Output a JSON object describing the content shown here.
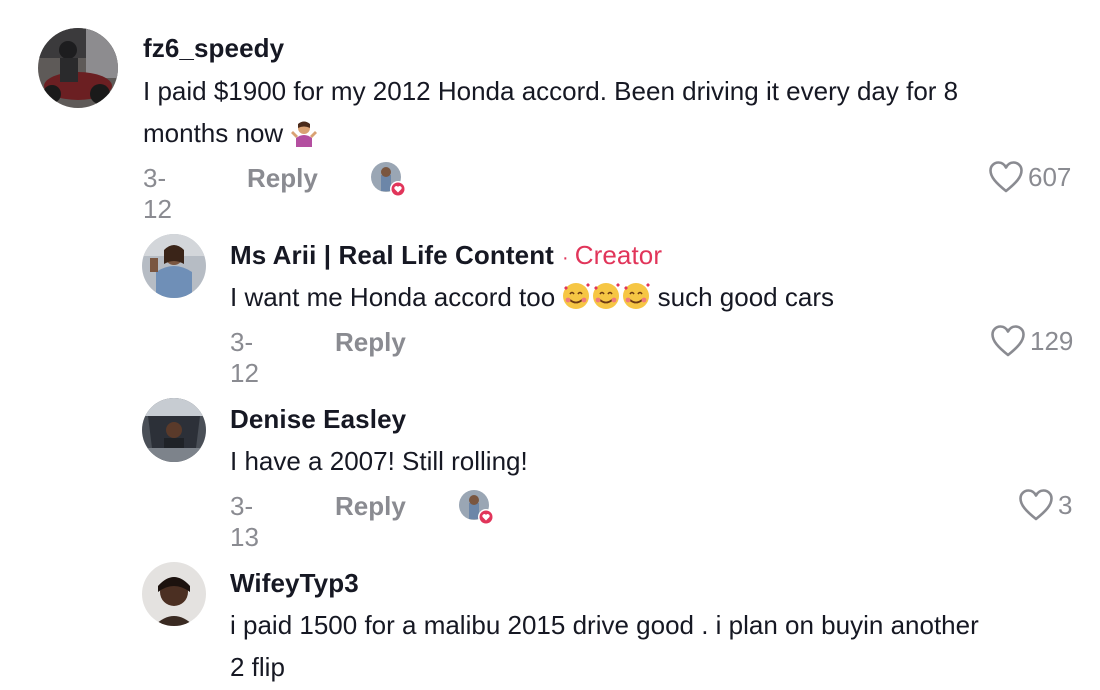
{
  "comments": [
    {
      "username": "fz6_speedy",
      "text": "I paid $1900 for my 2012 Honda accord. Been driving it every day for 8",
      "text_line2": "months now",
      "text_line2_emoji": "person-shrugging-emoji",
      "date": "3-12",
      "reply_label": "Reply",
      "likes": "607",
      "liked_by_creator": true
    },
    {
      "username": "Ms Arii | Real Life Content",
      "creator_separator": "·",
      "creator_label": "Creator",
      "text": "I want me Honda accord too",
      "text_emoji": "smiling-face-with-hearts-emoji",
      "text_after": "such good cars",
      "date": "3-12",
      "reply_label": "Reply",
      "likes": "129",
      "liked_by_creator": false
    },
    {
      "username": "Denise Easley",
      "text": "I have a 2007! Still rolling!",
      "date": "3-13",
      "reply_label": "Reply",
      "likes": "3",
      "liked_by_creator": true
    },
    {
      "username": "WifeyTyp3",
      "text": "i paid 1500 for a malibu 2015 drive good . i plan on buyin another",
      "text_line2": "2 flip"
    }
  ],
  "colors": {
    "creator_accent": "#e1355a",
    "meta_gray": "#8a8b91",
    "text_primary": "#161823"
  }
}
